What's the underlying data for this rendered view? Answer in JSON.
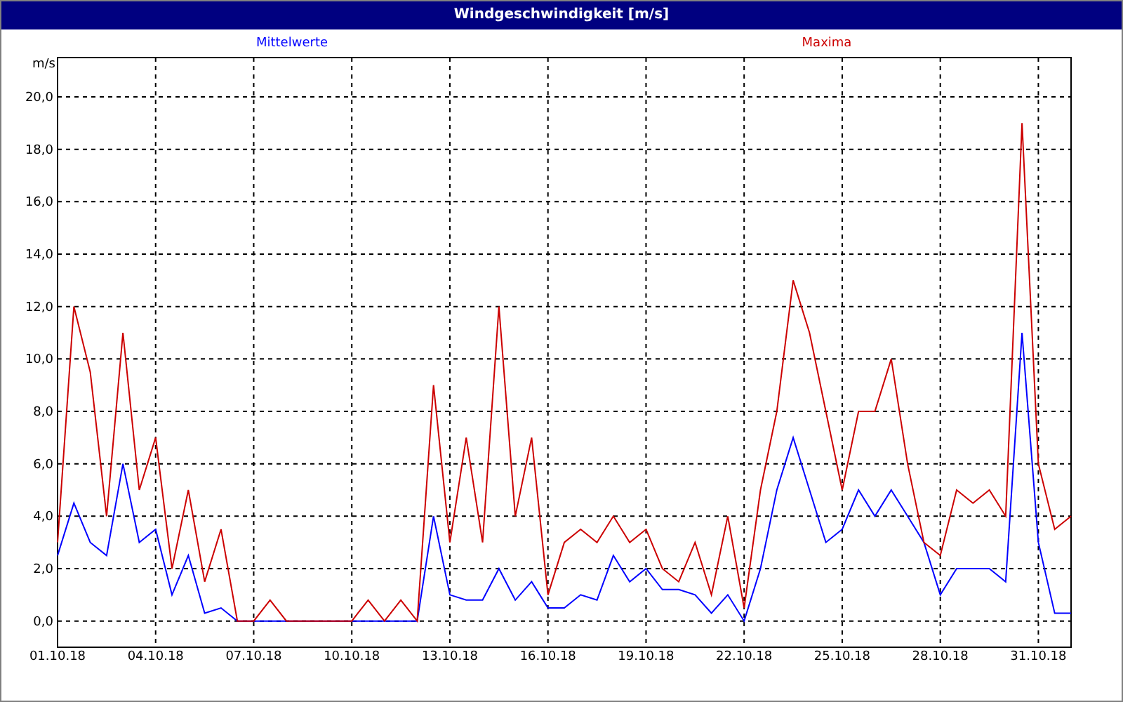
{
  "chart_data": {
    "type": "line",
    "grid": true,
    "title": "Windgeschwindigkeit [m/s]",
    "ylabel": "m/s",
    "categories": [
      "01.10.18",
      null,
      null,
      null,
      null,
      null,
      "04.10.18",
      null,
      null,
      null,
      null,
      null,
      "07.10.18",
      null,
      null,
      null,
      null,
      null,
      "10.10.18",
      null,
      null,
      null,
      null,
      null,
      "13.10.18",
      null,
      null,
      null,
      null,
      null,
      "16.10.18",
      null,
      null,
      null,
      null,
      null,
      "19.10.18",
      null,
      null,
      null,
      null,
      null,
      "22.10.18",
      null,
      null,
      null,
      null,
      null,
      "25.10.18",
      null,
      null,
      null,
      null,
      null,
      "28.10.18",
      null,
      null,
      null,
      null,
      null,
      "31.10.18",
      null,
      null
    ],
    "series": [
      {
        "name": "Mittelwerte",
        "color": "#0000ff",
        "values": [
          2.5,
          4.5,
          3,
          2.5,
          6,
          3,
          3.5,
          1,
          2.5,
          0.3,
          0.5,
          0,
          0,
          0,
          0,
          0,
          0,
          0,
          0,
          0,
          0,
          0,
          0,
          4,
          1,
          0.8,
          0.8,
          2,
          0.8,
          1.5,
          0.5,
          0.5,
          1,
          0.8,
          2.5,
          1.5,
          2,
          1.2,
          1.2,
          1,
          0.3,
          1,
          0,
          2,
          5,
          7,
          5,
          3,
          3.5,
          5,
          4,
          5,
          4,
          3,
          1,
          2,
          2,
          2,
          1.5,
          11,
          3,
          0.3,
          0.3
        ]
      },
      {
        "name": "Maxima",
        "color": "#cc0000",
        "values": [
          3,
          12,
          9.5,
          4,
          11,
          5,
          7,
          2,
          5,
          1.5,
          3.5,
          0,
          0,
          0.8,
          0,
          0,
          0,
          0,
          0,
          0.8,
          0,
          0.8,
          0,
          9,
          3,
          7,
          3,
          12,
          4,
          7,
          1,
          3,
          3.5,
          3,
          4,
          3,
          3.5,
          2,
          1.5,
          3,
          1,
          4,
          0.5,
          5,
          8,
          13,
          11,
          8,
          5,
          8,
          8,
          10,
          6,
          3,
          2.5,
          5,
          4.5,
          5,
          4,
          19,
          6,
          3.5,
          4
        ]
      }
    ],
    "ylim": [
      -1,
      21.5
    ],
    "yticks": [
      {
        "value": 0,
        "label": "0,0"
      },
      {
        "value": 2,
        "label": "2,0"
      },
      {
        "value": 4,
        "label": "4,0"
      },
      {
        "value": 6,
        "label": "6,0"
      },
      {
        "value": 8,
        "label": "8,0"
      },
      {
        "value": 10,
        "label": "10,0"
      },
      {
        "value": 12,
        "label": "12,0"
      },
      {
        "value": 14,
        "label": "14,0"
      },
      {
        "value": 16,
        "label": "16,0"
      },
      {
        "value": 18,
        "label": "18,0"
      },
      {
        "value": 20,
        "label": "20,0"
      }
    ]
  }
}
